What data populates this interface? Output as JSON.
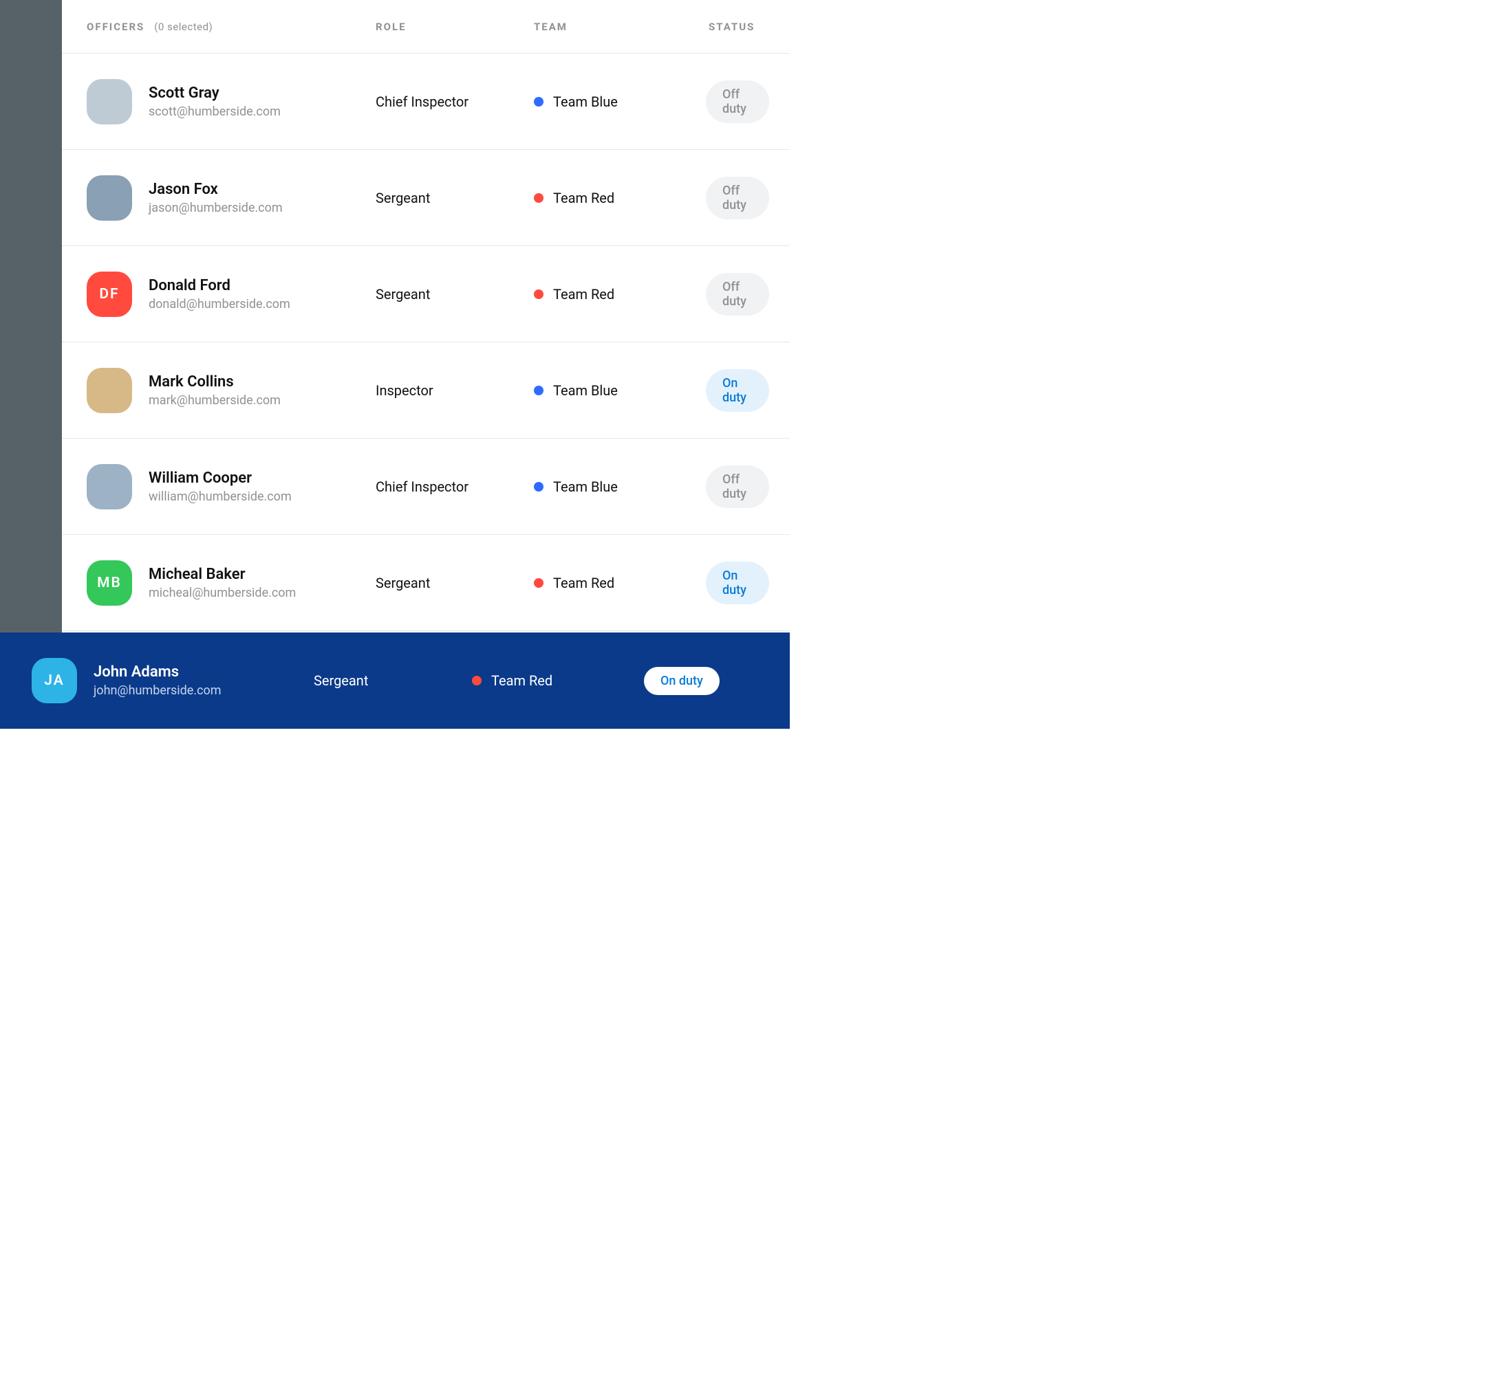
{
  "columns": {
    "officers": "OFFICERS",
    "selected": "(0 selected)",
    "role": "ROLE",
    "team": "TEAM",
    "status": "STATUS"
  },
  "teams": {
    "blue": {
      "label": "Team Blue",
      "color": "#2f6bff"
    },
    "red": {
      "label": "Team Red",
      "color": "#ff4a3d"
    }
  },
  "status": {
    "off": "Off duty",
    "on": "On duty"
  },
  "officers": [
    {
      "name": "Scott Gray",
      "email": "scott@humberside.com",
      "role": "Chief Inspector",
      "team": "blue",
      "status": "off",
      "avatar": {
        "type": "photo",
        "bg": "#bfcbd4"
      }
    },
    {
      "name": "Jason Fox",
      "email": "jason@humberside.com",
      "role": "Sergeant",
      "team": "red",
      "status": "off",
      "avatar": {
        "type": "photo",
        "bg": "#8aa0b5"
      }
    },
    {
      "name": "Donald Ford",
      "email": "donald@humberside.com",
      "role": "Sergeant",
      "team": "red",
      "status": "off",
      "avatar": {
        "type": "initials",
        "text": "DF",
        "bg": "#ff4a3d"
      }
    },
    {
      "name": "Mark Collins",
      "email": "mark@humberside.com",
      "role": "Inspector",
      "team": "blue",
      "status": "on",
      "avatar": {
        "type": "photo",
        "bg": "#d7b887"
      }
    },
    {
      "name": "William Cooper",
      "email": "william@humberside.com",
      "role": "Chief Inspector",
      "team": "blue",
      "status": "off",
      "avatar": {
        "type": "photo",
        "bg": "#9eb2c6"
      }
    },
    {
      "name": "Micheal Baker",
      "email": "micheal@humberside.com",
      "role": "Sergeant",
      "team": "red",
      "status": "on",
      "avatar": {
        "type": "initials",
        "text": "MB",
        "bg": "#34c759"
      }
    }
  ],
  "current_user": {
    "name": "John Adams",
    "email": "john@humberside.com",
    "role": "Sergeant",
    "team": "red",
    "status": "on",
    "avatar": {
      "type": "initials",
      "text": "JA",
      "bg": "#2db3e6"
    }
  }
}
